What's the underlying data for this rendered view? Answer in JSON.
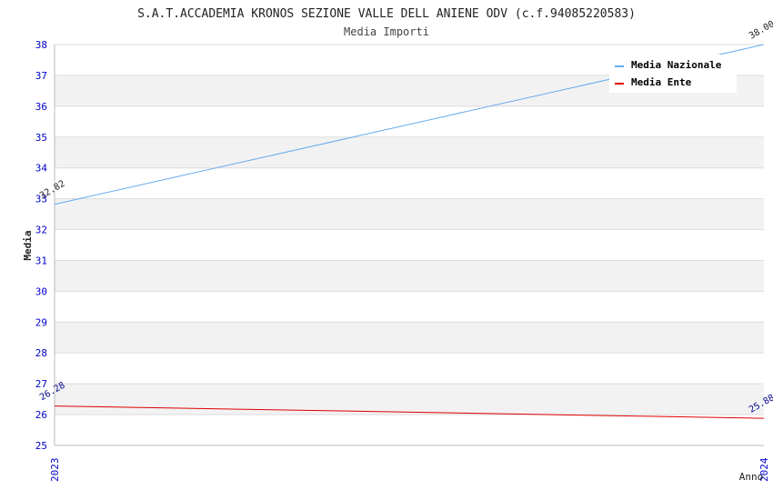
{
  "chart_data": {
    "type": "line",
    "title": "S.A.T.ACCADEMIA KRONOS SEZIONE VALLE DELL ANIENE ODV (c.f.94085220583)",
    "subtitle": "Media Importi",
    "xlabel": "Anno",
    "ylabel": "Media",
    "x": [
      "2023",
      "2024"
    ],
    "ylim": [
      25,
      38
    ],
    "yticks": [
      "25",
      "26",
      "27",
      "28",
      "29",
      "30",
      "31",
      "32",
      "33",
      "34",
      "35",
      "36",
      "37",
      "38"
    ],
    "grid": true,
    "legend_position": "top-right",
    "series": [
      {
        "name": "Media Nazionale",
        "values": [
          32.82,
          38.0
        ],
        "labels": [
          "32.82",
          "38.00"
        ],
        "color": "#66aaee"
      },
      {
        "name": "Media Ente",
        "values": [
          26.28,
          25.88
        ],
        "labels": [
          "26.28",
          "25.88"
        ],
        "color": "#dd0000"
      }
    ]
  },
  "colors": {
    "tick_label": "#0000cc",
    "band": "#f2f2f2",
    "grid": "#dddddd",
    "title": "#222222",
    "subtitle": "#444444"
  }
}
